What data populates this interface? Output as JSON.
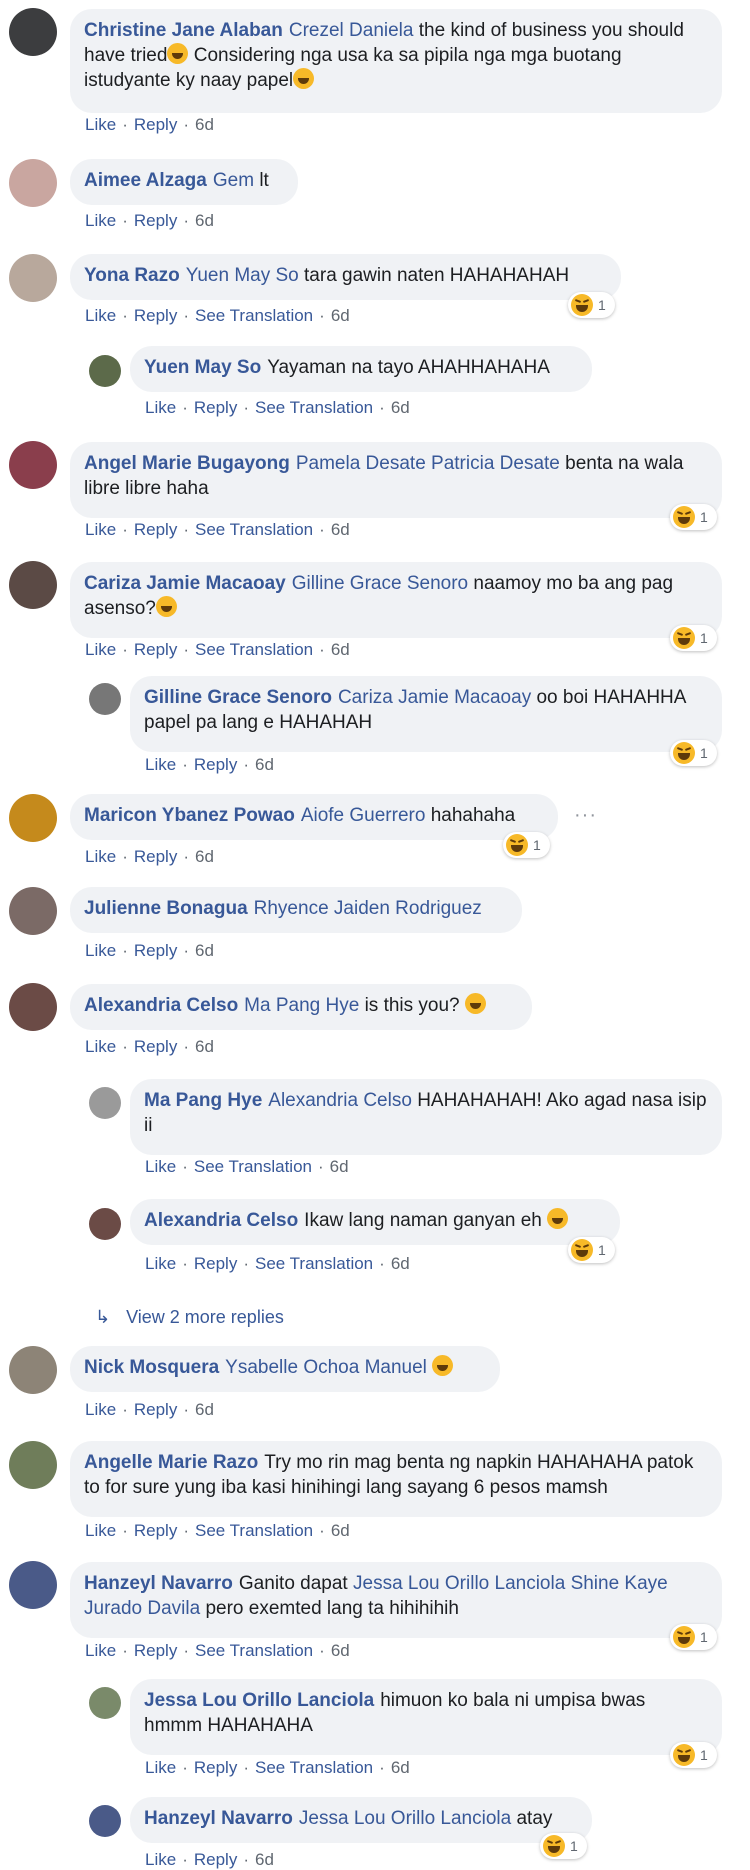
{
  "actions": {
    "like": "Like",
    "reply": "Reply",
    "see_translation": "See Translation"
  },
  "comments": [
    {
      "author": "Christine Jane Alaban",
      "tag": "Crezel Daniela",
      "text": "the kind of business you should have tried",
      "text2": " Considering nga usa ka sa pipila nga mga buotang istudyante ky naay papel",
      "time": "6d",
      "translate": false,
      "reactions": null,
      "avatar": "#3c3d3f"
    },
    {
      "author": "Aimee Alzaga",
      "tag": "Gem",
      "text": "lt",
      "time": "6d",
      "translate": false,
      "reactions": null,
      "avatar": "#c9a6a0"
    },
    {
      "author": "Yona Razo",
      "tag": "Yuen May So",
      "text": "tara gawin naten HAHAHAHAH",
      "time": "6d",
      "translate": true,
      "reactions": "1",
      "avatar": "#b8a89c"
    },
    {
      "author": "Yuen May So",
      "tag": "",
      "text": "Yayaman na tayo AHAHHAHAHA",
      "time": "6d",
      "translate": true,
      "reactions": null,
      "avatar": "#5c6a4a",
      "reply": true
    },
    {
      "author": "Angel Marie Bugayong",
      "tag": "Pamela Desate Patricia Desate",
      "text": "benta na wala libre libre haha",
      "time": "6d",
      "translate": true,
      "reactions": "1",
      "avatar": "#8a3e4c"
    },
    {
      "author": "Cariza Jamie Macaoay",
      "tag": "Gilline Grace Senoro",
      "text": "naamoy mo ba ang pag asenso?",
      "time": "6d",
      "translate": true,
      "reactions": "1",
      "avatar": "#5b4a45"
    },
    {
      "author": "Gilline Grace Senoro",
      "tag": "Cariza Jamie Macaoay",
      "text": "oo boi HAHAHHA papel pa lang e HAHAHAH",
      "time": "6d",
      "translate": false,
      "reactions": "1",
      "avatar": "#777",
      "reply": true
    },
    {
      "author": "Maricon Ybanez Powao",
      "tag": "Aiofe Guerrero",
      "text": "hahahaha",
      "time": "6d",
      "translate": false,
      "reactions": "1",
      "avatar": "#c58a1c"
    },
    {
      "author": "Julienne Bonagua",
      "tag": "Rhyence Jaiden Rodriguez",
      "text": "",
      "time": "6d",
      "translate": false,
      "reactions": null,
      "avatar": "#7b6a66"
    },
    {
      "author": "Alexandria Celso",
      "tag": "Ma Pang Hye",
      "text": "is this you?",
      "time": "6d",
      "translate": false,
      "reactions": null,
      "avatar": "#6b4b46"
    },
    {
      "author": "Ma Pang Hye",
      "tag": "Alexandria Celso",
      "text": "HAHAHAHAH! Ako agad nasa isip ii",
      "time": "6d",
      "translate": true,
      "reactions": null,
      "avatar": "#9a9a9a",
      "reply": true
    },
    {
      "author": "Alexandria Celso",
      "tag": "",
      "text": "Ikaw lang naman ganyan eh",
      "time": "6d",
      "translate": true,
      "reactions": "1",
      "avatar": "#6b4b46",
      "reply": true
    },
    {
      "author": "Nick Mosquera",
      "tag": "Ysabelle Ochoa Manuel",
      "text": "",
      "time": "6d",
      "translate": false,
      "reactions": null,
      "avatar": "#8d8477"
    },
    {
      "author": "Angelle Marie Razo",
      "tag": "",
      "text": "Try mo rin mag benta ng napkin HAHAHAHA patok to for sure yung iba kasi hinihingi lang sayang 6 pesos mamsh",
      "time": "6d",
      "translate": true,
      "reactions": null,
      "avatar": "#6f7d5a"
    },
    {
      "author": "Hanzeyl Navarro",
      "tag": "Jessa Lou Orillo Lanciola Shine Kaye Jurado Davila",
      "text": "Ganito dapat",
      "text2": "pero exemted lang ta hihihihih",
      "time": "6d",
      "translate": true,
      "reactions": "1",
      "avatar": "#4a5a88"
    },
    {
      "author": "Jessa Lou Orillo Lanciola",
      "tag": "",
      "text": "himuon ko bala ni umpisa bwas hmmm HAHAHAHA",
      "time": "6d",
      "translate": true,
      "reactions": "1",
      "avatar": "#7a8a6a",
      "reply": true
    },
    {
      "author": "Hanzeyl Navarro",
      "tag": "Jessa Lou Orillo Lanciola",
      "text": "atay",
      "time": "6d",
      "translate": false,
      "reactions": "1",
      "avatar": "#4a5a88",
      "reply": true
    }
  ],
  "view_more": "View 2 more replies",
  "reaction_colors": {
    "haha": "#f7b928"
  }
}
